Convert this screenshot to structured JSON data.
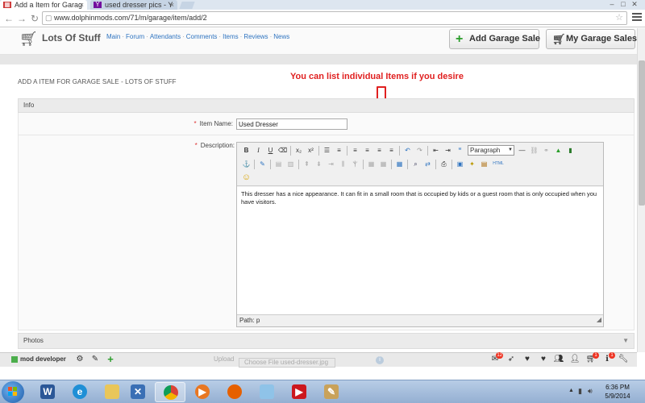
{
  "browser": {
    "tabs": [
      {
        "title": "Add a Item for Garag"
      },
      {
        "title": "used dresser pics - Y"
      }
    ],
    "url": "www.dolphinmods.com/71/m/garage/item/add/2"
  },
  "site": {
    "title": "Lots Of Stuff",
    "nav": [
      "Main",
      "Forum",
      "Attendants",
      "Comments",
      "Items",
      "Reviews",
      "News"
    ],
    "add_garage_sale_label": "Add Garage Sale",
    "my_garage_sales_label": "My Garage Sales"
  },
  "page": {
    "heading": "ADD A ITEM FOR GARAGE SALE - LOTS OF STUFF",
    "annotation": "You can list individual Items if you desire",
    "info_section": "Info",
    "photos_section": "Photos",
    "item_name_label": "Item Name:",
    "item_name_value": "Used Dresser",
    "description_label": "Description:",
    "required_marker": "*"
  },
  "editor": {
    "format_select": "Paragraph",
    "content": "This dresser has a nice appearance. It can fit in a small room that is occupied by kids or a guest room that is only occupied when you have visitors.",
    "path": "Path: p"
  },
  "userbar": {
    "name": "mod developer",
    "upload_label": "Upload",
    "choose_file_label": "Choose File",
    "file_name": "used-dresser.jpg",
    "badges": {
      "mail": "12",
      "cart": "1",
      "info": "1"
    }
  },
  "taskbar": {
    "time": "6:36 PM",
    "date": "5/9/2014"
  },
  "colors": {
    "link": "#2f74c0",
    "annotation": "#e02020",
    "add_icon": "#2a9d2a",
    "badge": "#ee3322"
  }
}
